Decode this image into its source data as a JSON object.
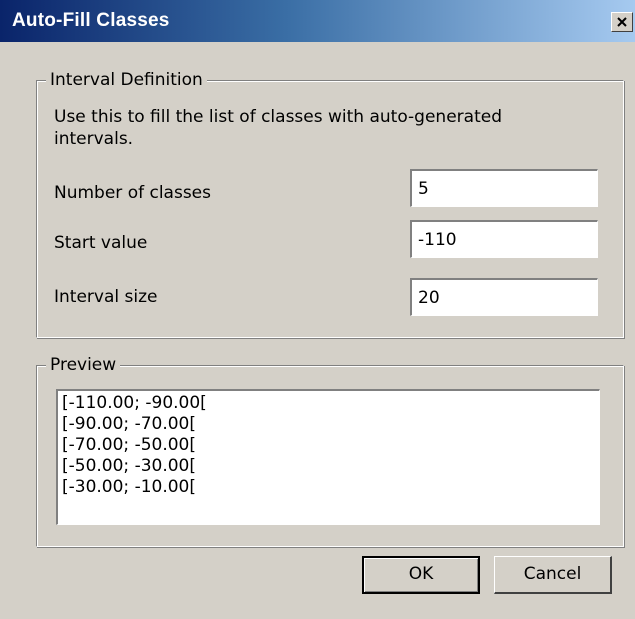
{
  "window": {
    "title": "Auto-Fill Classes",
    "close_glyph": "close-icon"
  },
  "interval_definition": {
    "legend": "Interval Definition",
    "description": "Use this to fill the list of classes with auto-generated intervals.",
    "fields": [
      {
        "label": "Number of classes",
        "value": "5"
      },
      {
        "label": "Start value",
        "value": "-110"
      },
      {
        "label": "Interval size",
        "value": "20"
      }
    ]
  },
  "preview": {
    "legend": "Preview",
    "lines": [
      "[-110.00; -90.00[",
      "[-90.00; -70.00[",
      "[-70.00; -50.00[",
      "[-50.00; -30.00[",
      "[-30.00; -10.00["
    ]
  },
  "buttons": {
    "ok": "OK",
    "cancel": "Cancel"
  },
  "colors": {
    "dialog_face": "#d4d0c8",
    "title_start": "#0a246a",
    "title_end": "#a6caf0"
  }
}
